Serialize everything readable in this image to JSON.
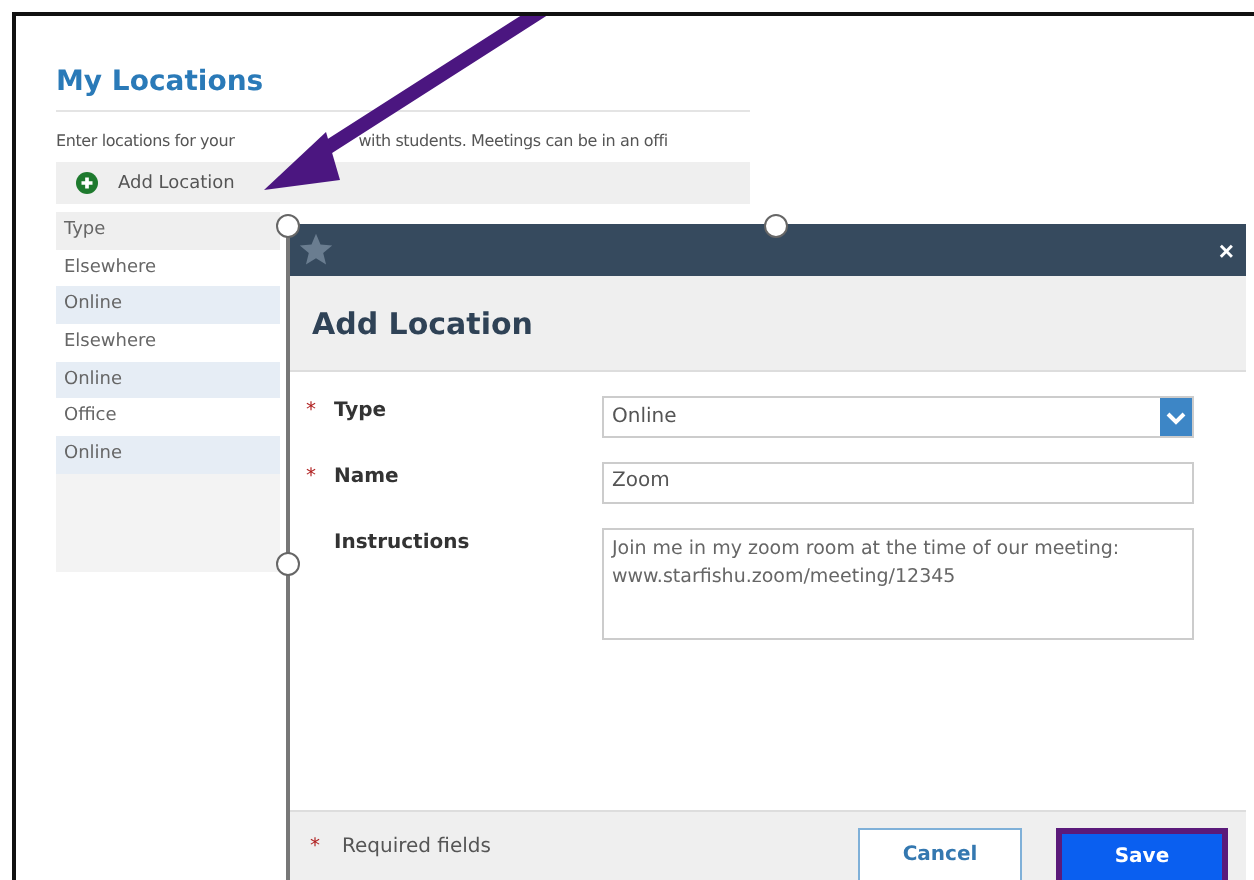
{
  "page": {
    "title": "My Locations",
    "description": [
      "Enter locations for your",
      "with students. Meetings can be in an offi"
    ],
    "toolbar": {
      "add_label": "Add Location"
    },
    "table": {
      "header": "Type",
      "rows": [
        "Elsewhere",
        "Online",
        "Elsewhere",
        "Online",
        "Office",
        "Online"
      ]
    }
  },
  "dialog": {
    "close": "×",
    "title": "Add Location",
    "fields": [
      {
        "kind": "select",
        "label": "Type",
        "required": true,
        "value": "Online"
      },
      {
        "kind": "text",
        "label": "Name",
        "required": true,
        "value": "Zoom"
      },
      {
        "kind": "textarea",
        "label": "Instructions",
        "required": false,
        "value": "Join me in my zoom room at the time of our meeting: www.starfishu.zoom/meeting/12345"
      }
    ],
    "footer": {
      "required_mark": "*",
      "required_note": "Required fields",
      "buttons": [
        {
          "label": "Cancel",
          "kind": "secondary",
          "highlighted": false
        },
        {
          "label": "Save",
          "kind": "primary",
          "highlighted": true
        }
      ]
    }
  }
}
